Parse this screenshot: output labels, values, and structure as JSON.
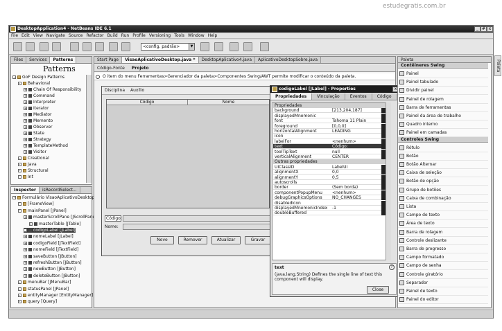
{
  "watermark": "estudegratis.com.br",
  "window": {
    "title": "DesktopApplication4 - NetBeans IDE 6.1",
    "min": "_",
    "max": "#",
    "close": "x"
  },
  "menu": [
    "File",
    "Edit",
    "View",
    "Navigate",
    "Source",
    "Refactor",
    "Build",
    "Run",
    "Profile",
    "Versioning",
    "Tools",
    "Window",
    "Help"
  ],
  "toolbar": {
    "config": "<config. padrão>"
  },
  "left_top": {
    "tabs": [
      "Files",
      "Services",
      "Patterns"
    ],
    "header": "Patterns",
    "tree": [
      {
        "label": "GoF Design Patterns",
        "level": 0
      },
      {
        "label": "Behavioral",
        "level": 1
      },
      {
        "label": "Chain Of Responsibility",
        "level": 2
      },
      {
        "label": "Command",
        "level": 2
      },
      {
        "label": "Interpreter",
        "level": 2
      },
      {
        "label": "Iterator",
        "level": 2
      },
      {
        "label": "Mediator",
        "level": 2
      },
      {
        "label": "Memento",
        "level": 2
      },
      {
        "label": "Observer",
        "level": 2
      },
      {
        "label": "State",
        "level": 2
      },
      {
        "label": "Strategy",
        "level": 2
      },
      {
        "label": "TemplateMethod",
        "level": 2
      },
      {
        "label": "Visitor",
        "level": 2
      },
      {
        "label": "Creational",
        "level": 1
      },
      {
        "label": "Java",
        "level": 1
      },
      {
        "label": "Structural",
        "level": 1
      },
      {
        "label": "Int",
        "level": 1
      }
    ]
  },
  "inspector": {
    "tabs": [
      "Inspector",
      "isRecordSelect..."
    ],
    "tree": [
      {
        "label": "Formulário VisaoAplicativoDesktop",
        "level": 0
      },
      {
        "label": "[FrameView]",
        "level": 1
      },
      {
        "label": "mainPanel [JPanel]",
        "level": 1
      },
      {
        "label": "masterScrollPane [JScrollPane]",
        "level": 2
      },
      {
        "label": "masterTable [JTable]",
        "level": 3
      },
      {
        "label": "codigoLabel [JLabel]",
        "level": 2,
        "selected": true
      },
      {
        "label": "nomeLabel [JLabel]",
        "level": 2
      },
      {
        "label": "codigoField [JTextField]",
        "level": 2
      },
      {
        "label": "nomeField [JTextField]",
        "level": 2
      },
      {
        "label": "saveButton [JButton]",
        "level": 2
      },
      {
        "label": "refreshButton [JButton]",
        "level": 2
      },
      {
        "label": "newButton [JButton]",
        "level": 2
      },
      {
        "label": "deleteButton [JButton]",
        "level": 2
      },
      {
        "label": "menuBar [JMenuBar]",
        "level": 1
      },
      {
        "label": "statusPanel [JPanel]",
        "level": 1
      },
      {
        "label": "entityManager [EntityManager]",
        "level": 1
      },
      {
        "label": "query [Query]",
        "level": 1
      }
    ]
  },
  "editor": {
    "tabs": [
      "Start Page",
      "VisaoAplicativoDesktop.java *",
      "DesktopAplicativo4.java",
      "AplicativoDesktopSobre.java"
    ],
    "subtabs": [
      "Código-Fonte",
      "Projeto"
    ],
    "hint": "O item do menu Ferramentas>Gerenciador da paleta>Componentes Swing/AWT permite modificar o conteúdo da paleta.",
    "form_menu": [
      "Disciplina",
      "Auxílio"
    ],
    "table_headers": [
      "Código",
      "Nome"
    ],
    "codigo_label": "Código:",
    "nome_label": "Nome:",
    "buttons": [
      "Novo",
      "Remover",
      "Atualizar",
      "Gravar"
    ]
  },
  "properties_dialog": {
    "title": "codigoLabel [JLabel] - Properties",
    "tabs": [
      "Propriedades",
      "Vinculação",
      "Eventos",
      "Código"
    ],
    "section1": "Propriedades",
    "rows1": [
      {
        "name": "background",
        "value": "[213,204,187]"
      },
      {
        "name": "displayedMnemonic",
        "value": ""
      },
      {
        "name": "font",
        "value": "Tahoma 11 Plain"
      },
      {
        "name": "foreground",
        "value": "[0,0,0]"
      },
      {
        "name": "horizontalAlignment",
        "value": "LEADING"
      },
      {
        "name": "icon",
        "value": ""
      },
      {
        "name": "labelFor",
        "value": "<nenhum>"
      },
      {
        "name": "text",
        "value": "Código:",
        "selected": true
      },
      {
        "name": "toolTipText",
        "value": "null"
      },
      {
        "name": "verticalAlignment",
        "value": "CENTER"
      }
    ],
    "section2": "Outras propriedades",
    "rows2": [
      {
        "name": "UIClassID",
        "value": "LabelUI"
      },
      {
        "name": "alignmentX",
        "value": "0,0"
      },
      {
        "name": "alignmentY",
        "value": "0,5"
      },
      {
        "name": "autoscrolls",
        "value": ""
      },
      {
        "name": "border",
        "value": "(Sem borda)"
      },
      {
        "name": "componentPopupMenu",
        "value": "<nenhum>"
      },
      {
        "name": "debugGraphicsOptions",
        "value": "NO_CHANGES"
      },
      {
        "name": "disabledIcon",
        "value": ""
      },
      {
        "name": "displayedMnemonicIndex",
        "value": "-1"
      },
      {
        "name": "doubleBuffered",
        "value": ""
      }
    ],
    "desc_title": "text",
    "desc_text": "(java.lang.String) Defines the single line of text this component will display.",
    "close": "Close"
  },
  "palette": {
    "title": "Paleta",
    "side_label": "Paleta",
    "cat1": "Contêineres Swing",
    "items1": [
      "Painel",
      "Painel tabulado",
      "Dividir painel",
      "Painel de rolagem",
      "Barra de ferramentas",
      "Painel da área de trabalho",
      "Quadro interno",
      "Painel em camadas"
    ],
    "cat2": "Controles Swing",
    "items2": [
      "Rótulo",
      "Botão",
      "Botão Alternar",
      "Caixa de seleção",
      "Botão de opção",
      "Grupo de botões",
      "Caixa de combinação",
      "Lista",
      "Campo de texto",
      "Área de texto",
      "Barra de rolagem",
      "Controle deslizante",
      "Barra de progresso",
      "Campo formatado",
      "Campo de senha",
      "Controle giratório",
      "Separador",
      "Painel de texto",
      "Painel do editor"
    ]
  }
}
